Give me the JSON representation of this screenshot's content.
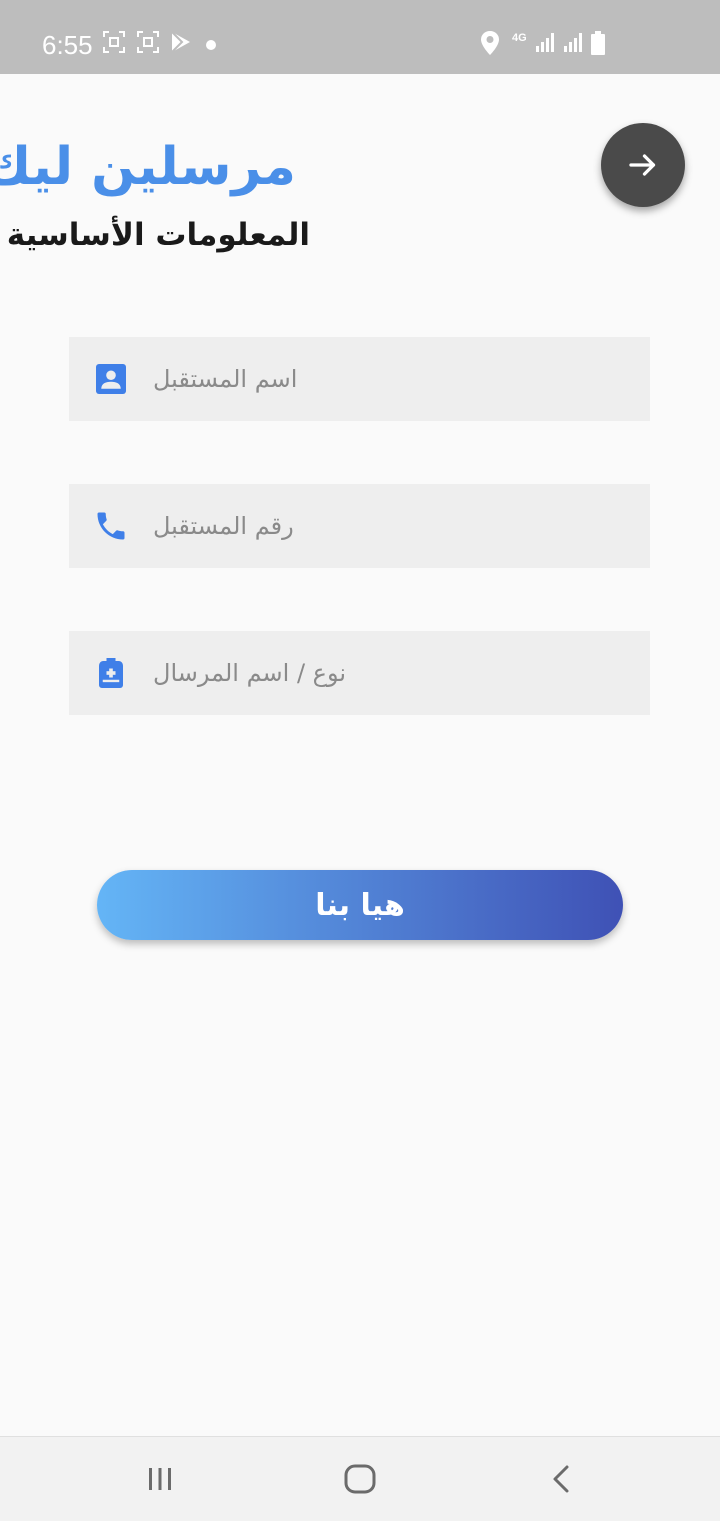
{
  "status_bar": {
    "time": "6:55",
    "network_label": "4G"
  },
  "header": {
    "app_title": "مرسلين ليك",
    "subtitle": "المعلومات الأساسية"
  },
  "form": {
    "receiver_name": {
      "placeholder": "اسم المستقبل",
      "value": "",
      "icon": "contact-card-icon"
    },
    "receiver_phone": {
      "placeholder": "رقم المستقبل",
      "value": "",
      "icon": "phone-icon"
    },
    "parcel_type": {
      "placeholder": "نوع / اسم المرسال",
      "value": "",
      "icon": "backpack-icon"
    }
  },
  "submit_label": "هيا بنا",
  "colors": {
    "accent_blue": "#4a8fe8",
    "gradient_start": "#64b5f6",
    "gradient_end": "#3f51b5",
    "fab": "#4a4a4a"
  }
}
